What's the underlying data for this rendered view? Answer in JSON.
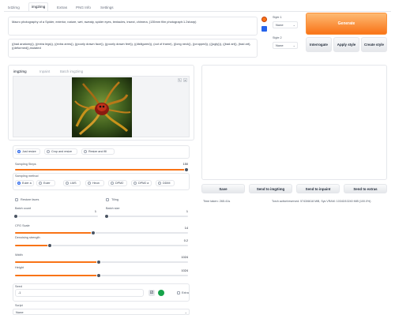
{
  "tabs": [
    {
      "label": "txt2img"
    },
    {
      "label": "img2img"
    },
    {
      "label": "Extras"
    },
    {
      "label": "PNG Info"
    },
    {
      "label": "Settings"
    }
  ],
  "prompt": {
    "text": "Macro photography of a Spider, exterior, nature, wet, sweaty, spider eyes, tentacles, insect, chimera, (135mm film photograph:1.2sharp)",
    "negative": "((bad anatomy)), ((extra legs)), ((extra arms)), ((poorly drawn face)), ((poorly drawn feet)), ((disfigured)), (out of frame), ((long neck)), ((cropped)), (((ugly))), ((bad art)), (bad art), ((deformed)),mutated"
  },
  "styles": {
    "style1_label": "Style 1",
    "style1_value": "None",
    "style2_label": "Style 2",
    "style2_value": "None"
  },
  "buttons": {
    "generate": "Generate",
    "interrogate": "Interrogate",
    "apply_style": "Apply style",
    "create_style": "Create style",
    "save": "Save",
    "send_img2img": "Send to img2img",
    "send_inpaint": "Send to inpaint",
    "send_extras": "Send to extras"
  },
  "subtabs": [
    {
      "label": "img2img"
    },
    {
      "label": "Inpaint"
    },
    {
      "label": "Batch img2img"
    }
  ],
  "resize": {
    "options": [
      "Just resize",
      "Crop and resize",
      "Resize and fill"
    ],
    "selected": "Just resize"
  },
  "sampling": {
    "steps_label": "Sampling Steps",
    "steps_value": "150",
    "steps_fraction": 1.0,
    "method_label": "Sampling method",
    "methods": [
      "Euler a",
      "Euler",
      "LMS",
      "Heun",
      "DPM2",
      "DPM2 a",
      "DDIM"
    ],
    "selected_method": "Euler a"
  },
  "checks": {
    "restore_faces": "Restore faces",
    "tiling": "Tiling",
    "extra": "Extra"
  },
  "batch": {
    "count_label": "Batch count",
    "count_value": "1",
    "size_label": "Batch size",
    "size_value": "1"
  },
  "cfg": {
    "label": "CFG Scale",
    "value": "14",
    "fraction": 0.45
  },
  "denoise": {
    "label": "Denoising strength",
    "value": "0.2",
    "fraction": 0.2
  },
  "width": {
    "label": "Width",
    "value": "1024",
    "fraction": 0.45
  },
  "height": {
    "label": "Height",
    "value": "1024",
    "fraction": 0.45
  },
  "seed": {
    "label": "Seed",
    "value": "-1"
  },
  "script": {
    "label": "Script",
    "value": "None"
  },
  "output": {
    "time_taken": "Time taken: 265.41s",
    "torch_stats": "Torch active/reserved: 5743/6618 MiB, Sys VRAM: 10343/10240 MiB (100.0%)"
  },
  "colors": {
    "accent": "#f97316",
    "slider_accent": "#2563eb"
  },
  "icons": {
    "paste": "paste-params-icon",
    "image_close": "close-icon",
    "image_edit": "edit-icon",
    "seed_random": "dice-icon",
    "seed_reuse": "recycle-icon"
  }
}
